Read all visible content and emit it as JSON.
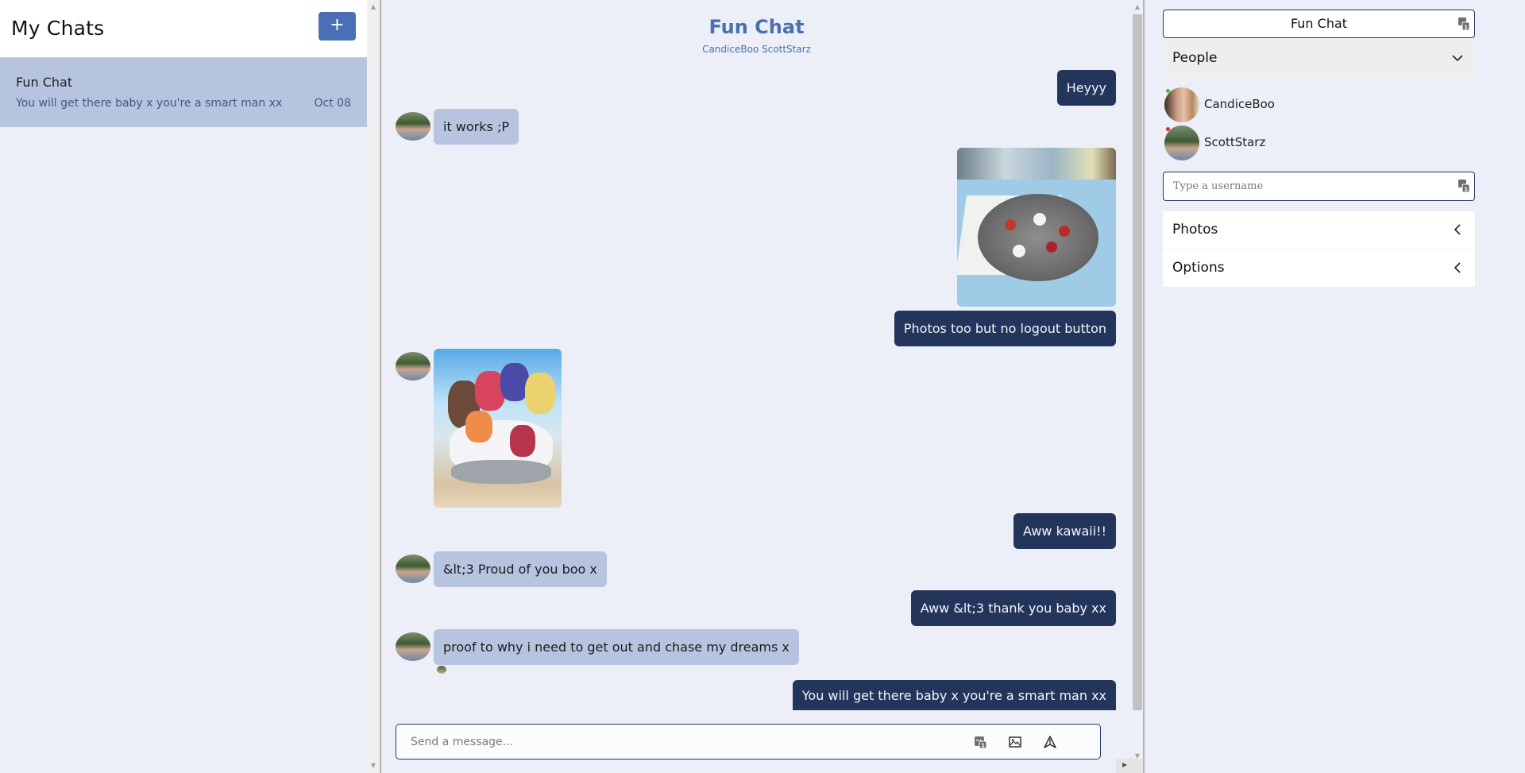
{
  "sidebar": {
    "title": "My Chats",
    "new_chat_label": "+",
    "chats": [
      {
        "title": "Fun Chat",
        "preview": "You will get there baby x you're a smart man xx",
        "date": "Oct 08",
        "selected": true
      }
    ]
  },
  "chat": {
    "title": "Fun Chat",
    "members": "CandiceBoo ScottStarz",
    "messages": [
      {
        "side": "right",
        "type": "text",
        "text": "Heyyy"
      },
      {
        "side": "left",
        "type": "text",
        "text": "it works ;P",
        "sender": "ScottStarz"
      },
      {
        "side": "right",
        "type": "image",
        "alt": "dessert plate photo"
      },
      {
        "side": "right",
        "type": "text",
        "text": "Photos too but no logout button"
      },
      {
        "side": "left",
        "type": "image",
        "alt": "anime group illustration",
        "sender": "ScottStarz"
      },
      {
        "side": "right",
        "type": "text",
        "text": "Aww kawaii!!"
      },
      {
        "side": "left",
        "type": "text",
        "text": "&lt;3 Proud of you boo x",
        "sender": "ScottStarz"
      },
      {
        "side": "right",
        "type": "text",
        "text": "Aww &lt;3 thank you baby xx"
      },
      {
        "side": "left",
        "type": "text",
        "text": "proof to why i need to get out and chase my dreams x",
        "sender": "ScottStarz"
      },
      {
        "side": "right",
        "type": "text",
        "text": "You will get there baby x you're a smart man xx"
      }
    ],
    "composer": {
      "placeholder": "Send a message...",
      "value": "",
      "icons": [
        "gif-icon",
        "image-upload-icon",
        "send-icon"
      ]
    }
  },
  "panel": {
    "chat_name": "Fun Chat",
    "people_label": "People",
    "people": [
      {
        "name": "CandiceBoo",
        "status": "online",
        "status_color": "#3cc43c"
      },
      {
        "name": "ScottStarz",
        "status": "offline",
        "status_color": "#e8242f"
      }
    ],
    "username_placeholder": "Type a username",
    "photos_label": "Photos",
    "options_label": "Options"
  },
  "colors": {
    "accent": "#4a6fb5",
    "own_bubble": "#24355c",
    "other_bubble": "#b6c4e0",
    "background": "#eceff7"
  }
}
